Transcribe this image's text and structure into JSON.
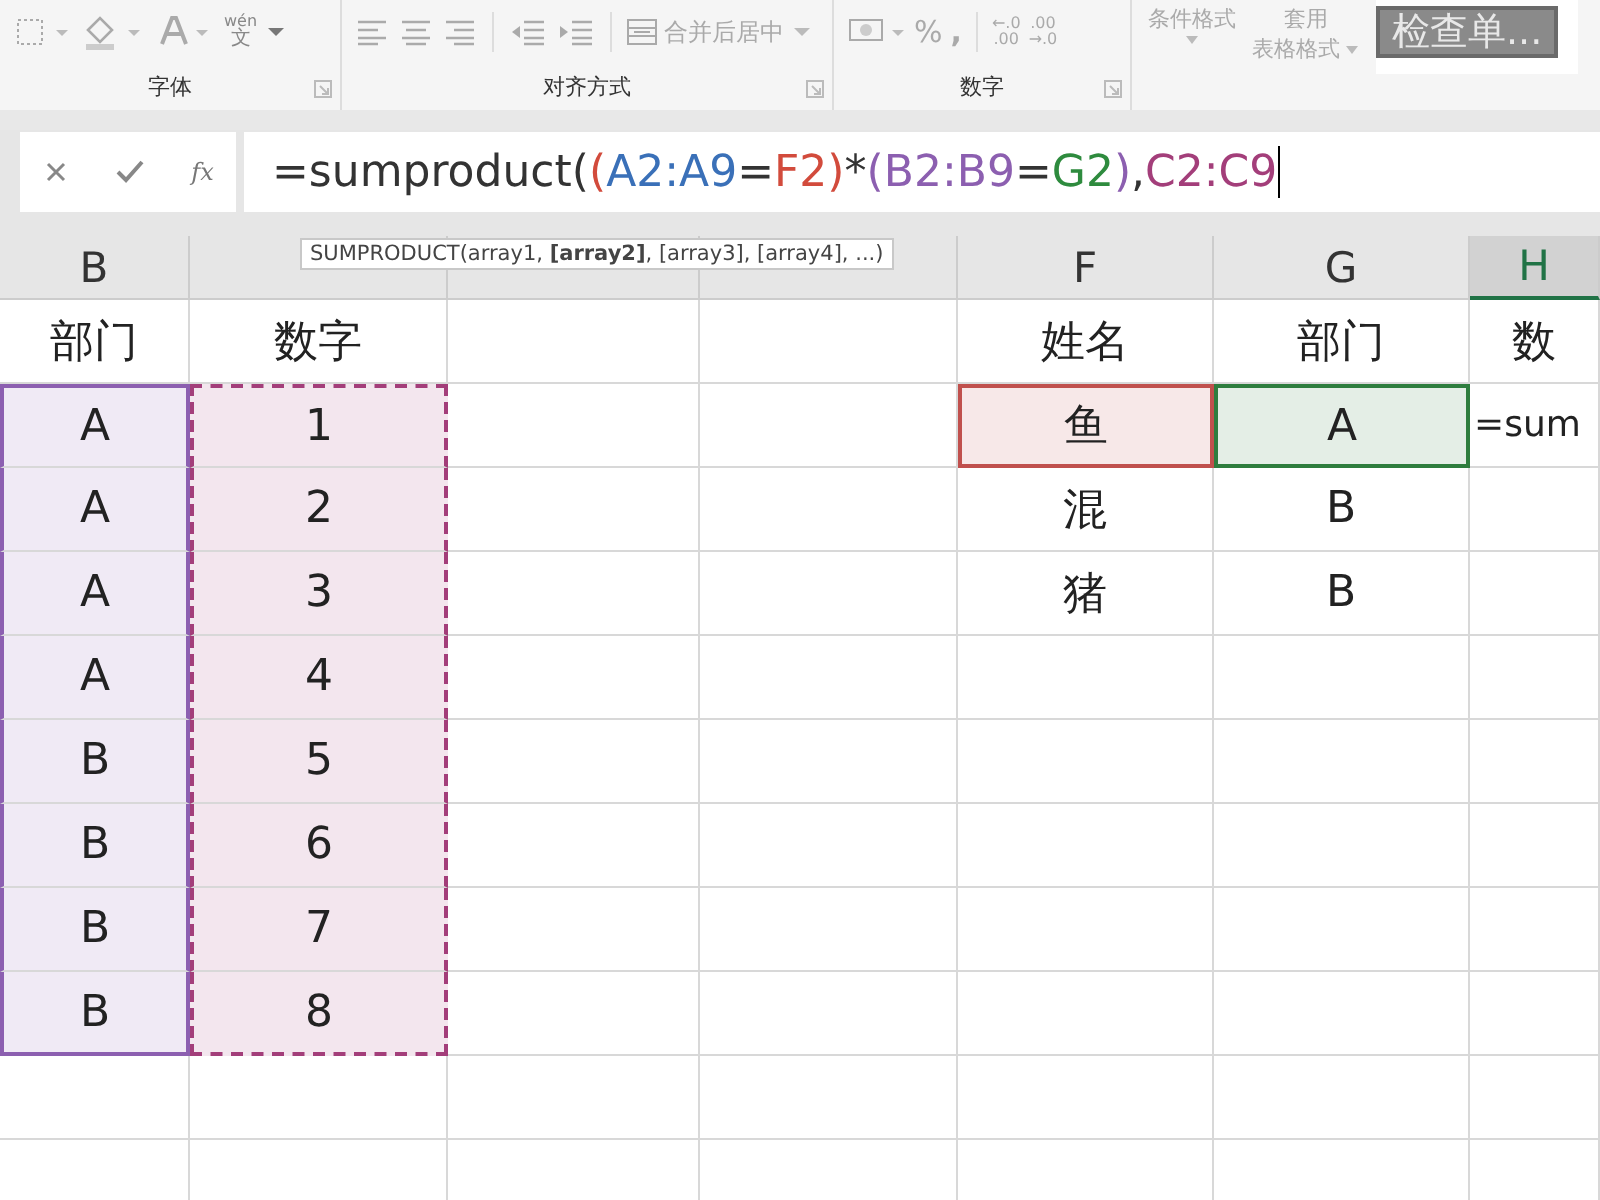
{
  "ribbon": {
    "font_group": {
      "label": "字体",
      "phonetic": {
        "top": "wén",
        "bottom": "文"
      }
    },
    "align_group": {
      "label": "对齐方式",
      "merge_label": "合并后居中"
    },
    "number_group": {
      "label": "数字",
      "percent": "%",
      "comma": ",",
      "increase_decimal": [
        "←.0",
        ".00"
      ],
      "decrease_decimal": [
        ".00",
        "→.0"
      ]
    },
    "styles_group": {
      "conditional": "条件格式",
      "table_style": [
        "套用",
        "表格格式"
      ],
      "check_box_text": "检查单..."
    }
  },
  "formula_bar": {
    "fx": "fx",
    "segments": [
      {
        "text": "=sumproduct(",
        "color": "#333333"
      },
      {
        "text": "(",
        "color": "#d24b3c"
      },
      {
        "text": "A2:A9",
        "color": "#3a70b8"
      },
      {
        "text": "=",
        "color": "#333333"
      },
      {
        "text": "F2",
        "color": "#d24b3c"
      },
      {
        "text": ")",
        "color": "#d24b3c"
      },
      {
        "text": "*",
        "color": "#333333"
      },
      {
        "text": "(",
        "color": "#8c5fb0"
      },
      {
        "text": "B2:B9",
        "color": "#8c5fb0"
      },
      {
        "text": "=",
        "color": "#333333"
      },
      {
        "text": "G2",
        "color": "#2e8b3e"
      },
      {
        "text": ")",
        "color": "#8c5fb0"
      },
      {
        "text": ",",
        "color": "#333333"
      },
      {
        "text": "C2:C9",
        "color": "#a33e7a"
      }
    ]
  },
  "tooltip": "SUMPRODUCT(array1, **[array2]**, [array3], [array4], ...)",
  "columns": [
    {
      "label": "B",
      "selected": false
    },
    {
      "selected": false
    },
    {
      "selected": false
    },
    {
      "selected": false
    },
    {
      "label": "F",
      "selected": false
    },
    {
      "label": "G",
      "selected": false
    },
    {
      "label": "H",
      "selected": true
    }
  ],
  "rows": [
    {
      "cells": [
        {
          "text": "部门"
        },
        {
          "text": "数字"
        },
        null,
        null,
        {
          "text": "姓名"
        },
        {
          "text": "部门"
        },
        {
          "text": "数"
        }
      ]
    },
    {
      "cells": [
        {
          "text": "A",
          "color": "#8c5fb0"
        },
        {
          "text": "1",
          "color": "#a33e7a",
          "marquee": true
        },
        null,
        null,
        {
          "text": "鱼",
          "color": "#c0504d"
        },
        {
          "text": "A",
          "color": "#2e7d3e"
        },
        {
          "text": "=sum",
          "editing": true
        }
      ]
    },
    {
      "cells": [
        {
          "text": "A",
          "color": "#8c5fb0"
        },
        {
          "text": "2",
          "color": "#a33e7a",
          "marquee": true
        },
        null,
        null,
        {
          "text": "混"
        },
        {
          "text": "B"
        },
        null
      ]
    },
    {
      "cells": [
        {
          "text": "A",
          "color": "#8c5fb0"
        },
        {
          "text": "3",
          "color": "#a33e7a",
          "marquee": true
        },
        null,
        null,
        {
          "text": "猪"
        },
        {
          "text": "B"
        },
        null
      ]
    },
    {
      "cells": [
        {
          "text": "A",
          "color": "#8c5fb0"
        },
        {
          "text": "4",
          "color": "#a33e7a",
          "marquee": true
        },
        null,
        null,
        null,
        null,
        null
      ]
    },
    {
      "cells": [
        {
          "text": "B",
          "color": "#8c5fb0"
        },
        {
          "text": "5",
          "color": "#a33e7a",
          "marquee": true
        },
        null,
        null,
        null,
        null,
        null
      ]
    },
    {
      "cells": [
        {
          "text": "B",
          "color": "#8c5fb0"
        },
        {
          "text": "6",
          "color": "#a33e7a",
          "marquee": true
        },
        null,
        null,
        null,
        null,
        null
      ]
    },
    {
      "cells": [
        {
          "text": "B",
          "color": "#8c5fb0"
        },
        {
          "text": "7",
          "color": "#a33e7a",
          "marquee": true
        },
        null,
        null,
        null,
        null,
        null
      ]
    },
    {
      "cells": [
        {
          "text": "B",
          "color": "#8c5fb0"
        },
        {
          "text": "8",
          "color": "#a33e7a",
          "marquee": true
        },
        null,
        null,
        null,
        null,
        null
      ]
    }
  ]
}
